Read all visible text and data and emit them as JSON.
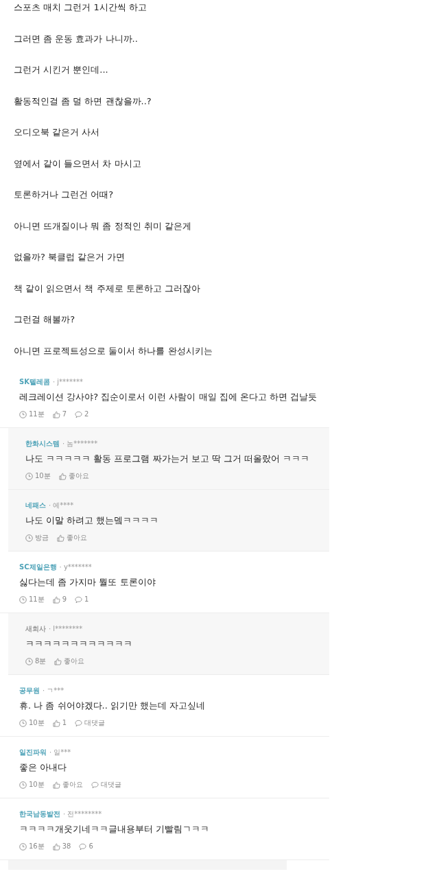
{
  "post_lines": [
    "스포츠 매치 그런거 1시간씩 하고",
    "그러면 좀 운동 효과가 나니까..",
    "그런거 시킨거 뿐인데...",
    "활동적인걸 좀 덜 하면 괜찮을까..?",
    "오디오북 같은거 사서",
    "옆에서 같이 들으면서 차 마시고",
    "토론하거나 그런건 어때?",
    "아니면 뜨개질이나 뭐 좀 정적인 취미 같은게",
    "없을까? 북클럽 같은거 가면",
    "책 같이 읽으면서 책 주제로 토론하고 그러잖아",
    "그런걸 해볼까?",
    "아니면 프로젝트성으로 둘이서 하나를 완성시키는"
  ],
  "comments": [
    {
      "kind": "comment",
      "company": "SK텔레콤",
      "color": "#4fa3b8",
      "user": "· j*******",
      "text": "레크레이션 강사야? 집순이로서 이런 사람이 매일 집에 온다고 하면 겁날듯",
      "time": "11분",
      "likes": "7",
      "replies": "2"
    },
    {
      "kind": "reply",
      "company": "한화시스템",
      "color": "#4fa3b8",
      "user": "· 놈*******",
      "text": "나도 ㅋㅋㅋㅋㅋ 활동 프로그램 짜가는거 보고 딱 그거 떠올랐어 ㅋㅋㅋ",
      "time": "10분",
      "likes": "좋아요"
    },
    {
      "kind": "reply",
      "company": "네패스",
      "color": "#4fa3b8",
      "user": "· 예****",
      "text": "나도 이말 하려고 했는뎈ㅋㅋㅋㅋ",
      "time": "방금",
      "likes": "좋아요"
    },
    {
      "kind": "comment",
      "company": "SC제일은행",
      "color": "#4fa3b8",
      "user": "· y*******",
      "text": "싫다는데 좀 가지마 뭘또 토론이야",
      "time": "11분",
      "likes": "9",
      "replies": "1"
    },
    {
      "kind": "reply",
      "company": "새회사",
      "color": "#999999",
      "user": "· l********",
      "text": "ㅋㅋㅋㅋㅋㅋㅋㅋㅋㅋㅋㅋ",
      "time": "8분",
      "likes": "좋아요"
    },
    {
      "kind": "comment",
      "company": "공무원",
      "color": "#4fa3b8",
      "user": "· ㄱ***",
      "text": "휴. 나 좀 쉬어야겠다.. 읽기만 했는데 자고싶네",
      "time": "10분",
      "likes": "1",
      "replies": "대댓글"
    },
    {
      "kind": "comment",
      "company": "일진파워",
      "color": "#4fa3b8",
      "user": "· 일***",
      "text": "좋은 아내다",
      "time": "10분",
      "likes": "좋아요",
      "replies": "대댓글"
    },
    {
      "kind": "comment",
      "company": "한국남동발전",
      "color": "#4fa3b8",
      "user": "· 전********",
      "text": "ㅋㅋㅋㅋ개웃기네ㅋㅋ글내용부터 기빨림ㄱㅋㅋ",
      "time": "16분",
      "likes": "38",
      "replies": "6"
    }
  ]
}
